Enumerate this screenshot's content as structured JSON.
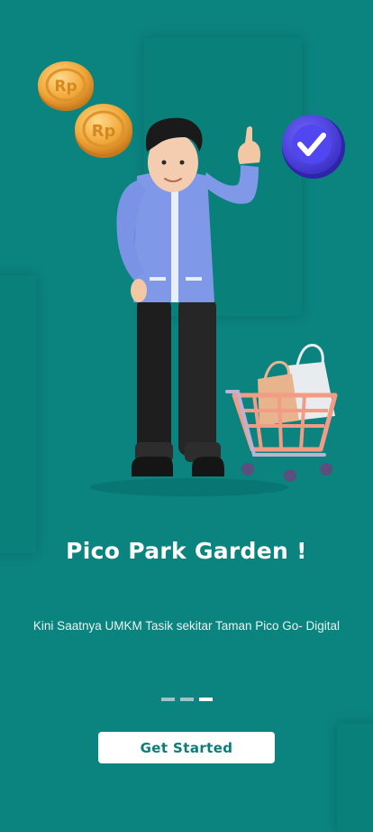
{
  "onboarding": {
    "title": "Pico Park Garden !",
    "subtitle": "Kini Saatnya UMKM Tasik sekitar Taman Pico Go- Digital",
    "coin_label": "Rp",
    "pagination": {
      "total": 3,
      "active_index": 2
    },
    "cta_label": "Get Started"
  },
  "colors": {
    "background": "#0b847f",
    "accent": "#0b7c78",
    "badge": "#4b3fe0"
  },
  "icons": [
    "rupiah-coin-icon",
    "check-badge-icon",
    "shopping-cart-icon",
    "shopping-bag-icon"
  ]
}
